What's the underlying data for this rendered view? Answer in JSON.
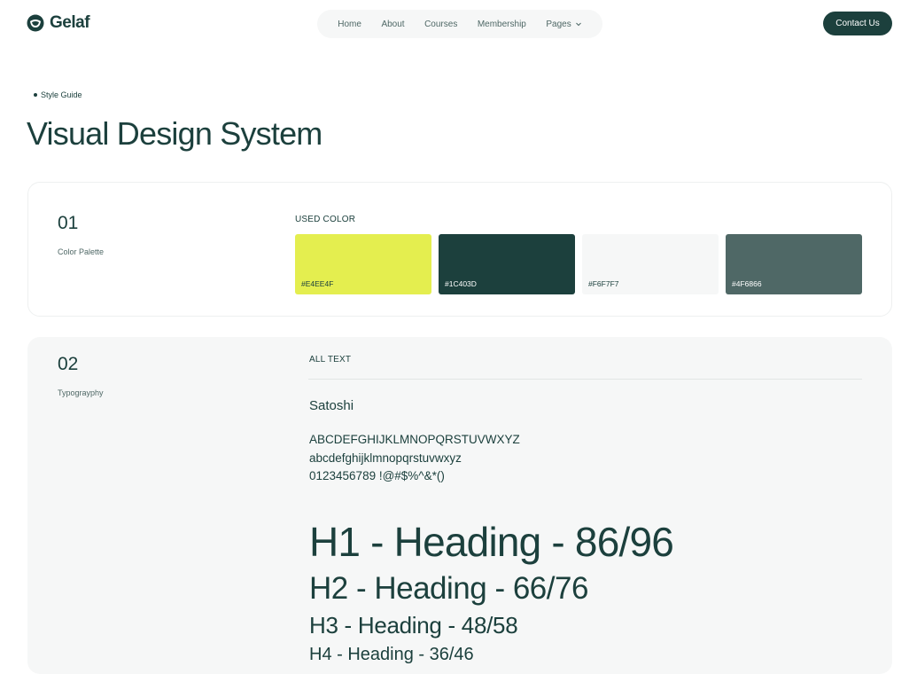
{
  "header": {
    "logo_text": "Gelaf",
    "nav": [
      "Home",
      "About",
      "Courses",
      "Membership",
      "Pages"
    ],
    "contact_label": "Contact Us"
  },
  "intro": {
    "eyebrow": "Style Guide",
    "title": "Visual Design System"
  },
  "palette": {
    "number": "01",
    "label": "Color Palette",
    "section_label": "USED  COLOR",
    "swatches": [
      {
        "hex": "#E4EE4F",
        "label": "#E4EE4F"
      },
      {
        "hex": "#1C403D",
        "label": "#1C403D"
      },
      {
        "hex": "#F6F7F7",
        "label": "#F6F7F7"
      },
      {
        "hex": "#4F6866",
        "label": "#4F6866"
      }
    ]
  },
  "typography": {
    "number": "02",
    "label": "Typograyphy",
    "section_label": "ALL TEXT",
    "font_name": "Satoshi",
    "uppercase": "ABCDEFGHIJKLMNOPQRSTUVWXYZ",
    "lowercase": "abcdefghijklmnopqrstuvwxyz",
    "digits": "0123456789 !@#$%^&*()",
    "headings": [
      "H1 - Heading - 86/96",
      "H2 - Heading - 66/76",
      "H3 - Heading - 48/58",
      "H4 - Heading - 36/46"
    ]
  },
  "colors": {
    "primary": "#1C403D",
    "accent": "#E4EE4F",
    "surface": "#F6F7F7",
    "muted": "#4F6866"
  }
}
